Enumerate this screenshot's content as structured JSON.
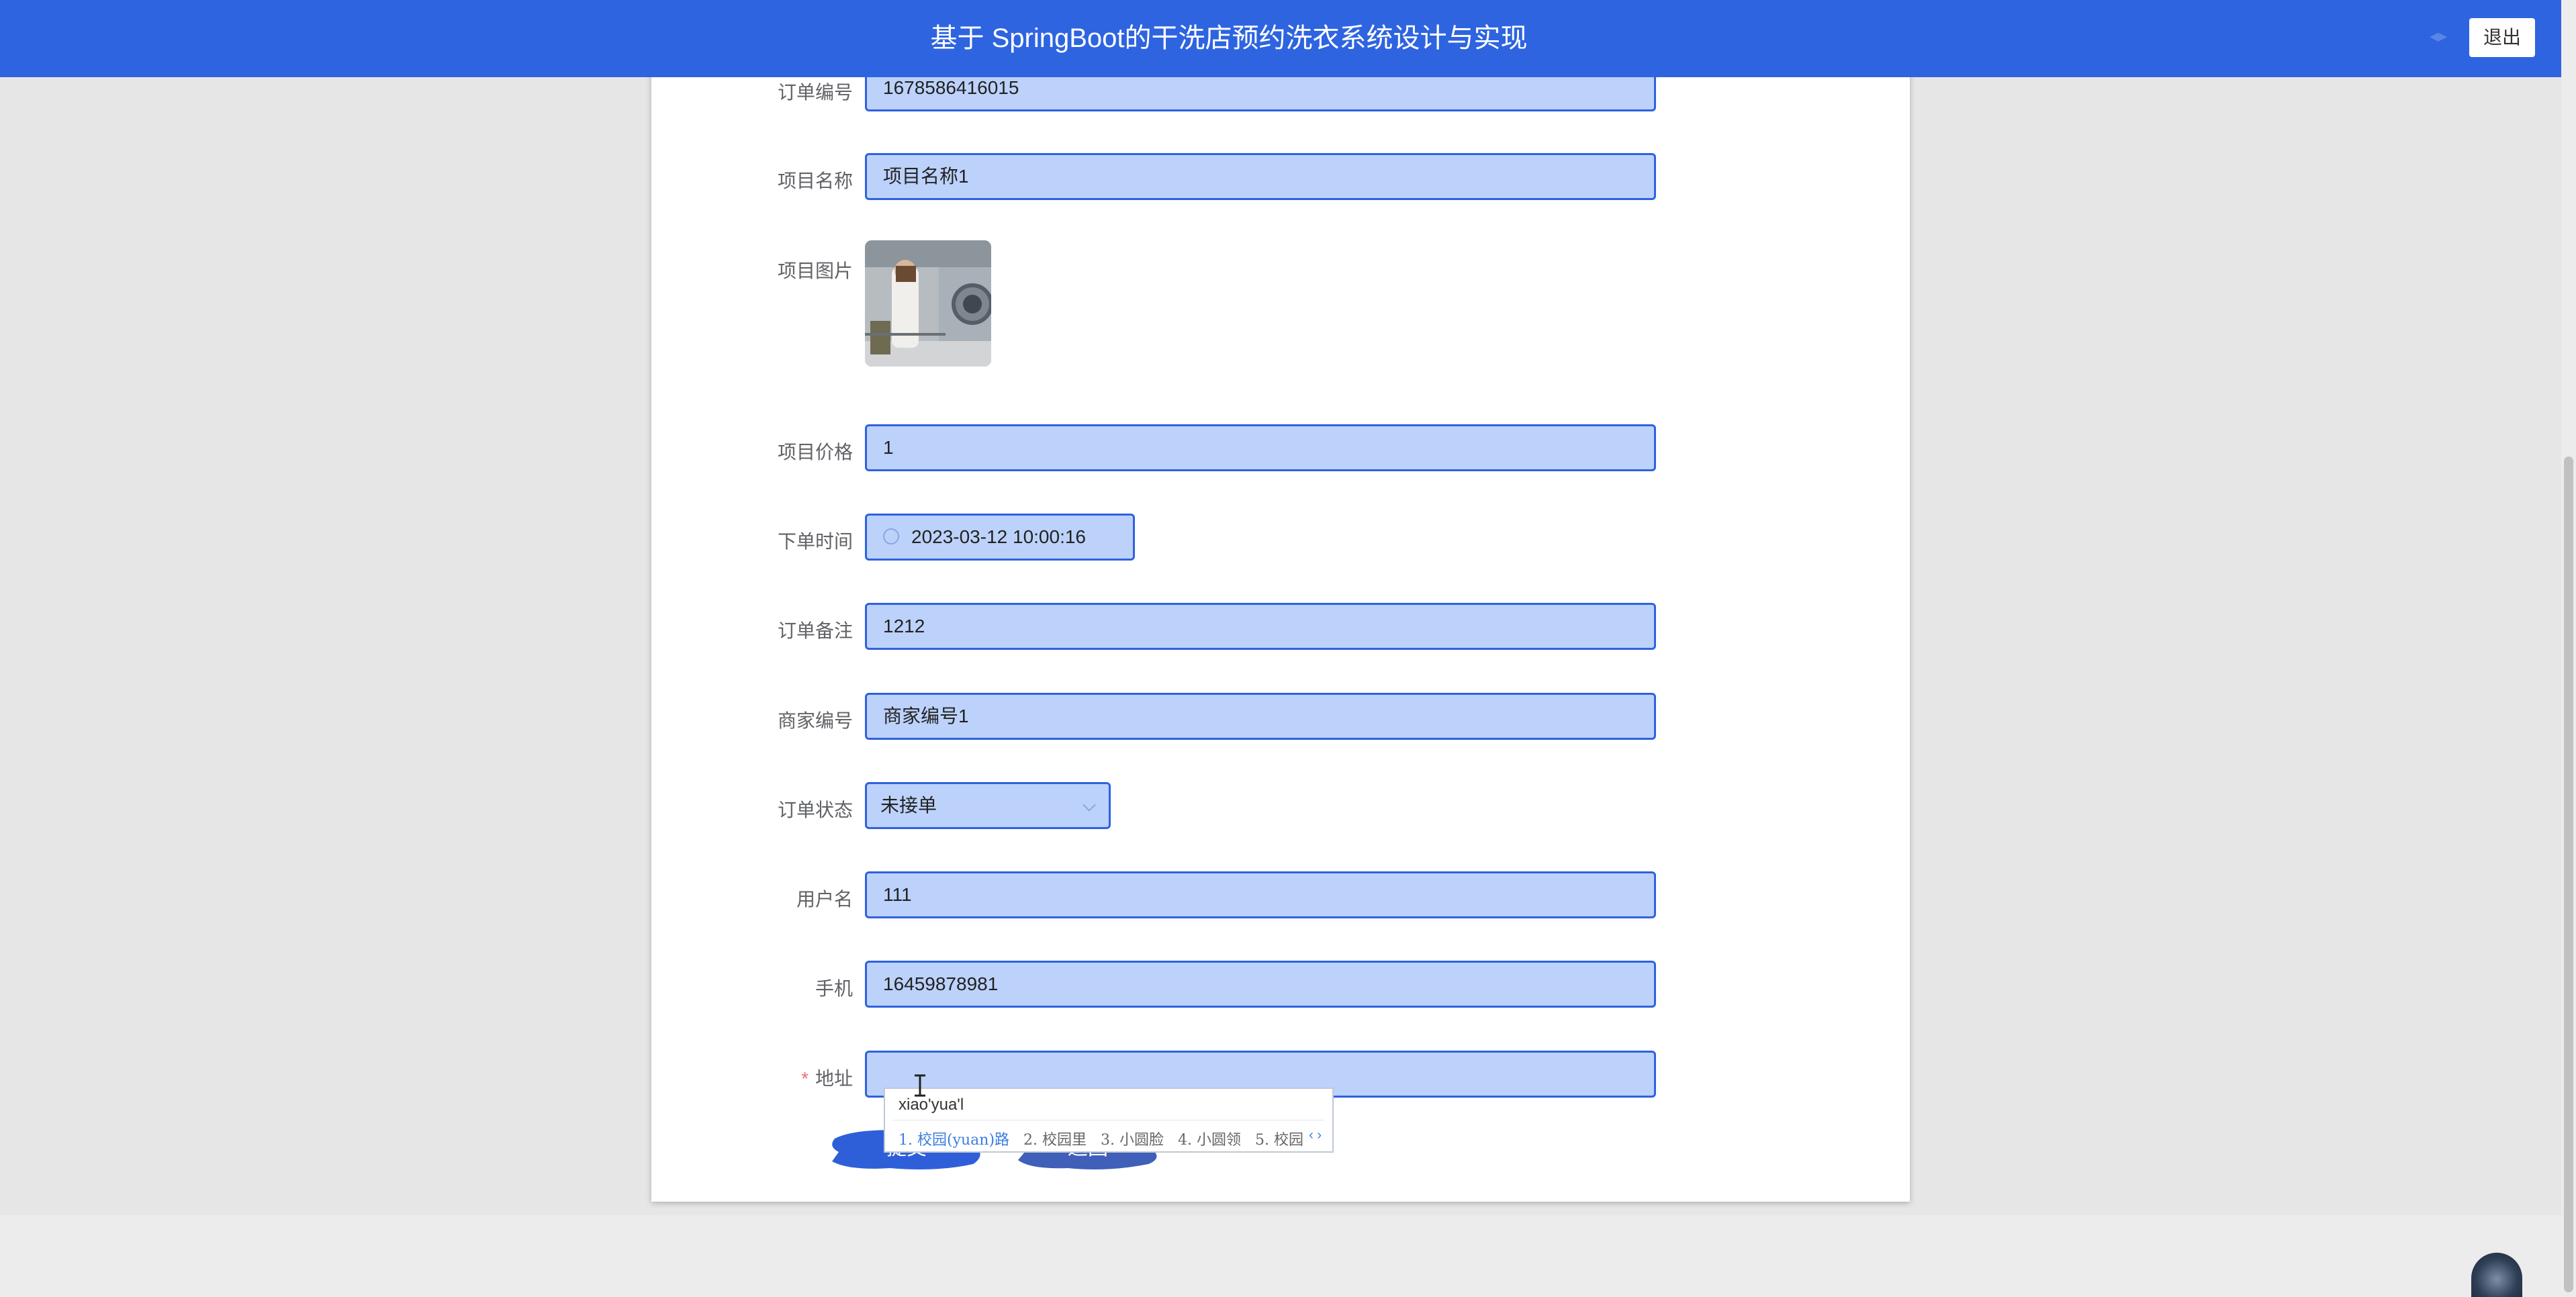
{
  "header": {
    "title": "基于 SpringBoot的干洗店预约洗衣系统设计与实现",
    "logout_label": "退出"
  },
  "form": {
    "order_no": {
      "label": "订单编号",
      "value": "1678586416015"
    },
    "item_name": {
      "label": "项目名称",
      "value": "项目名称1"
    },
    "item_image": {
      "label": "项目图片"
    },
    "item_price": {
      "label": "项目价格",
      "value": "1"
    },
    "order_time": {
      "label": "下单时间",
      "value": "2023-03-12 10:00:16"
    },
    "order_note": {
      "label": "订单备注",
      "value": "1212"
    },
    "merchant_no": {
      "label": "商家编号",
      "value": "商家编号1"
    },
    "order_status": {
      "label": "订单状态",
      "value": "未接单"
    },
    "username": {
      "label": "用户名",
      "value": "111"
    },
    "phone": {
      "label": "手机",
      "value": "16459878981"
    },
    "address": {
      "label": "地址",
      "required_mark": "*",
      "value": ""
    }
  },
  "buttons": {
    "submit": "提交",
    "back": "返回"
  },
  "ime": {
    "composition": "xiao'yua'l",
    "candidates": [
      "1. 校园(yuan)路",
      "2. 校园里",
      "3. 小圆脸",
      "4. 小圆领",
      "5. 校园"
    ],
    "nav": "‹ ›"
  },
  "colors": {
    "header_bg": "#2e64e0",
    "field_bg": "#bcd2fb",
    "field_border": "#2f62de",
    "required": "#f56c6c"
  }
}
